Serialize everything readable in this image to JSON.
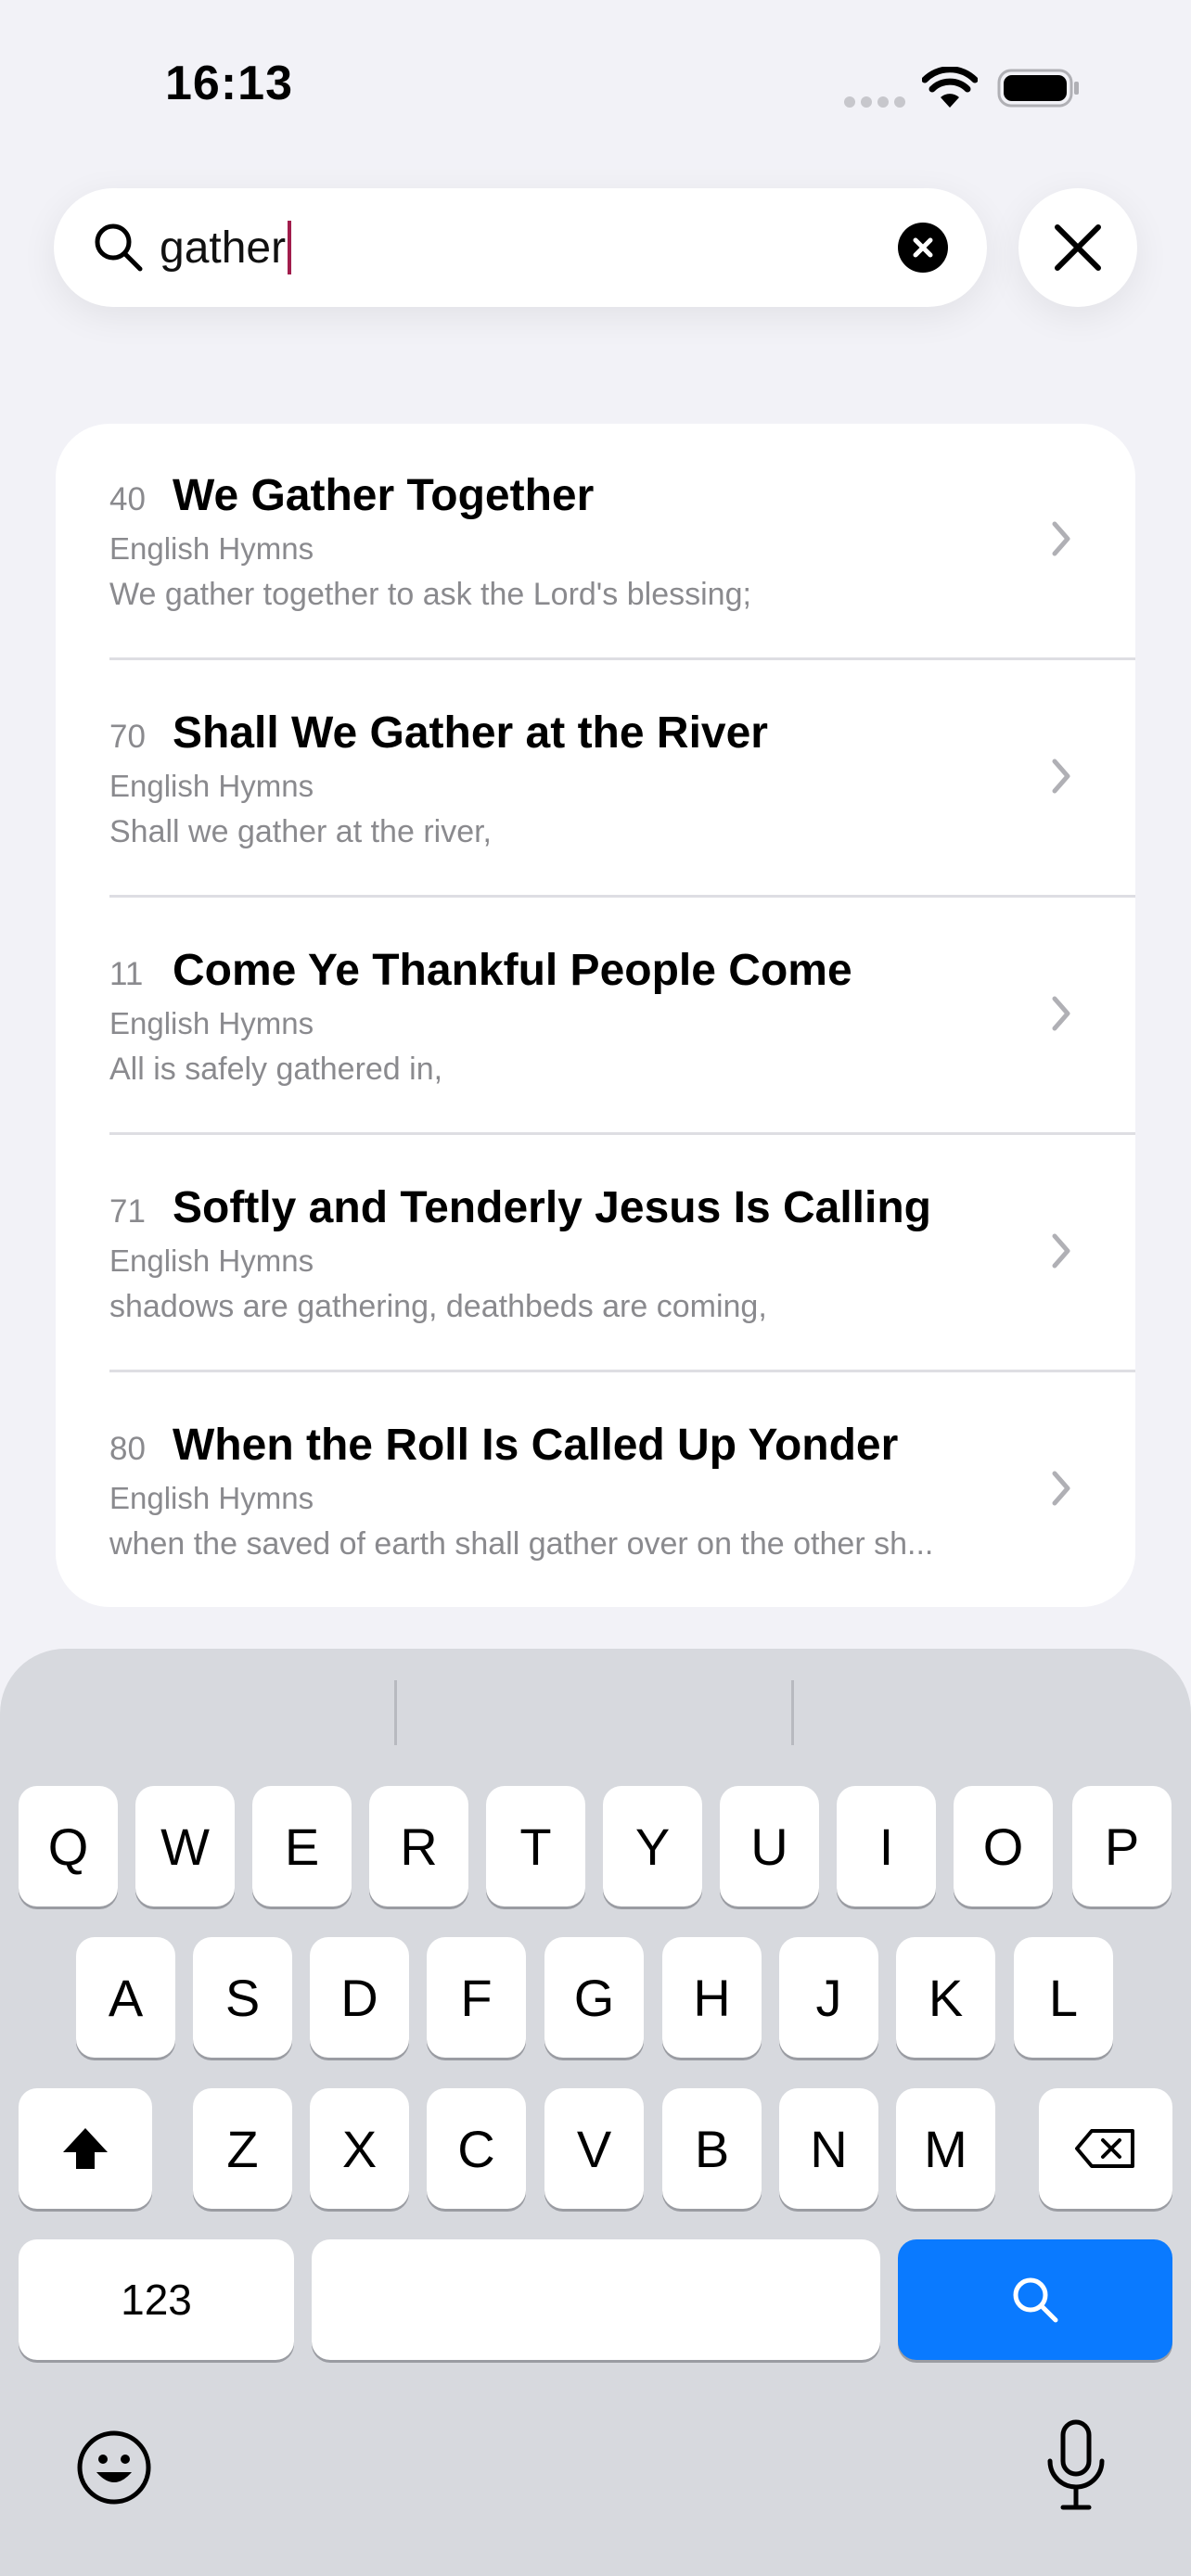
{
  "status_bar": {
    "time": "16:13"
  },
  "search": {
    "value": "gather"
  },
  "results": [
    {
      "number": "40",
      "title": "We Gather Together",
      "book": "English Hymns",
      "snippet": "We gather together to ask the Lord's blessing;"
    },
    {
      "number": "70",
      "title": "Shall We Gather at the River",
      "book": "English Hymns",
      "snippet": "Shall we gather at the river,"
    },
    {
      "number": "11",
      "title": "Come Ye Thankful People Come",
      "book": "English Hymns",
      "snippet": "All is safely gathered in,"
    },
    {
      "number": "71",
      "title": "Softly and Tenderly Jesus Is Calling",
      "book": "English Hymns",
      "snippet": "shadows are gathering, deathbeds are coming,"
    },
    {
      "number": "80",
      "title": "When the Roll Is Called Up Yonder",
      "book": "English Hymns",
      "snippet": "when the saved of earth shall gather over on the other sh..."
    }
  ],
  "keyboard": {
    "row1": [
      "Q",
      "W",
      "E",
      "R",
      "T",
      "Y",
      "U",
      "I",
      "O",
      "P"
    ],
    "row2": [
      "A",
      "S",
      "D",
      "F",
      "G",
      "H",
      "J",
      "K",
      "L"
    ],
    "row3": [
      "Z",
      "X",
      "C",
      "V",
      "B",
      "N",
      "M"
    ],
    "numbers_label": "123"
  },
  "colors": {
    "accent": "#0a7aff",
    "caret": "#a11d4c",
    "background": "#f2f2f7",
    "keyboard": "#d7d9de"
  },
  "icons": [
    "search-icon",
    "clear-icon",
    "close-icon",
    "chevron-right-icon",
    "shift-icon",
    "delete-icon",
    "emoji-icon",
    "microphone-icon",
    "wifi-icon",
    "battery-icon"
  ]
}
